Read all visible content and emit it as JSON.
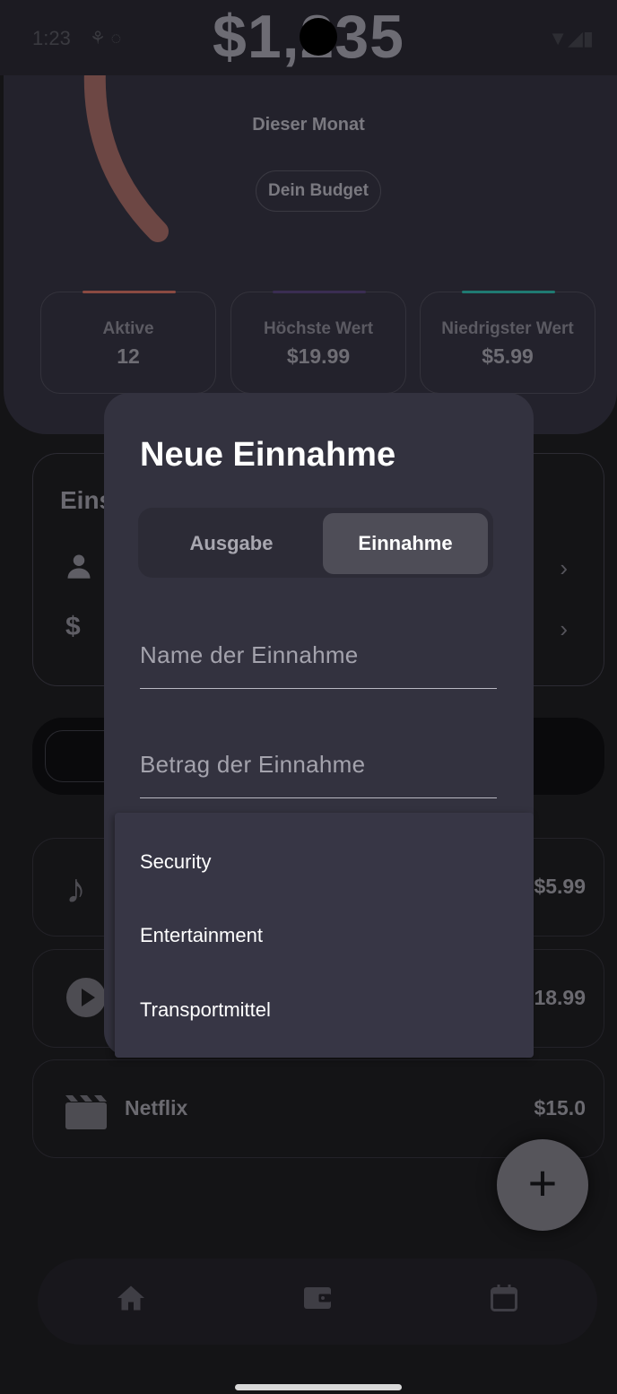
{
  "status_bar": {
    "time": "1:23"
  },
  "header": {
    "amount": "$1,235",
    "period": "Dieser Monat",
    "budget_chip": "Dein Budget",
    "gauge_color": "#a86a5f"
  },
  "stats": [
    {
      "label": "Aktive",
      "value": "12",
      "accent": "#8a4a42"
    },
    {
      "label": "Höchste Wert",
      "value": "$19.99",
      "accent": "#3a2d52"
    },
    {
      "label": "Niedrigster Wert",
      "value": "$5.99",
      "accent": "#1f7a72"
    }
  ],
  "section": {
    "title_partial": "Eins"
  },
  "subscriptions": [
    {
      "icon": "music-note-icon",
      "name": "",
      "price": "$5.99"
    },
    {
      "icon": "play-circle-icon",
      "name": "",
      "price": "18.99"
    },
    {
      "icon": "clapperboard-icon",
      "name": "Netflix",
      "price": "$15.0"
    }
  ],
  "dialog": {
    "title": "Neue Einnahme",
    "segments": {
      "expense": "Ausgabe",
      "income": "Einnahme",
      "selected": "income"
    },
    "name_placeholder": "Name der Einnahme",
    "amount_placeholder": "Betrag der Einnahme",
    "dropdown_options": [
      "Security",
      "Entertainment",
      "Transportmittel"
    ]
  },
  "fab": {
    "icon": "plus-icon"
  },
  "bottom_nav": {
    "items": [
      "home-icon",
      "wallet-icon",
      "calendar-icon"
    ]
  }
}
